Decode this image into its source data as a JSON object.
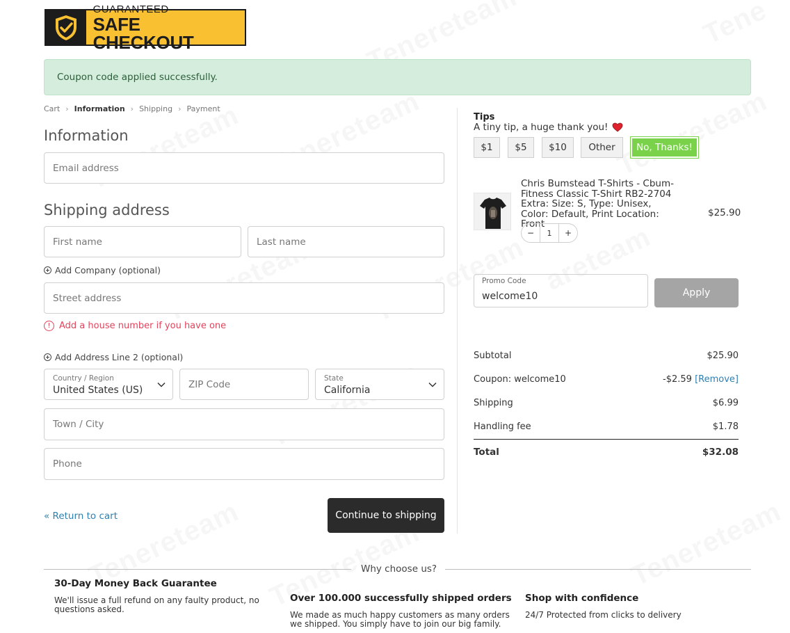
{
  "badge": {
    "top": "GUARANTEED",
    "bottom": "SAFE CHECKOUT"
  },
  "notice": "Coupon code applied successfully.",
  "breadcrumb": [
    "Cart",
    "Information",
    "Shipping",
    "Payment"
  ],
  "information": {
    "heading": "Information",
    "email_placeholder": "Email address"
  },
  "shipping": {
    "heading": "Shipping address",
    "first_name_placeholder": "First name",
    "last_name_placeholder": "Last name",
    "add_company": "Add Company (optional)",
    "street_placeholder": "Street address",
    "street_warning": "Add a house number if you have one",
    "add_line2": "Add Address Line 2 (optional)",
    "country_label": "Country / Region",
    "country_value": "United States (US)",
    "zip_placeholder": "ZIP Code",
    "state_label": "State",
    "state_value": "California",
    "city_placeholder": "Town / City",
    "phone_placeholder": "Phone"
  },
  "actions": {
    "return": "« Return to cart",
    "continue": "Continue to shipping"
  },
  "tips": {
    "title": "Tips",
    "subtitle": "A tiny tip, a huge thank you!",
    "options": [
      "$1",
      "$5",
      "$10",
      "Other",
      "No, Thanks!"
    ],
    "selected": "No, Thanks!",
    "accent": "#7ad24b"
  },
  "product": {
    "name": "Chris Bumstead T-Shirts - Cbum-Fitness Classic T-Shirt RB2-2704",
    "extra": "Extra: Size: S, Type: Unisex, Color: Default, Print Location: Front",
    "price": "$25.90",
    "quantity": "1",
    "minus": "−",
    "plus": "+"
  },
  "promo": {
    "label": "Promo Code",
    "value": "welcome10",
    "apply": "Apply"
  },
  "summary": {
    "subtotal_label": "Subtotal",
    "subtotal": "$25.90",
    "coupon_label": "Coupon: welcome10",
    "coupon_value": "-$2.59",
    "coupon_remove": "[Remove]",
    "shipping_label": "Shipping",
    "shipping": "$6.99",
    "handling_label": "Handling fee",
    "handling": "$1.78",
    "total_label": "Total",
    "total": "$32.08"
  },
  "why": {
    "title": "Why choose us?",
    "features": [
      {
        "title": "30-Day Money Back Guarantee",
        "text": "We'll issue a full refund on any faulty product, no questions asked."
      },
      {
        "title": "Over 100.000 successfully shipped orders",
        "text": "We made as much happy customers as many orders we shipped. You simply have to join our big family."
      },
      {
        "title": "Shop with confidence",
        "text": "24/7 Protected from clicks to delivery"
      }
    ]
  },
  "colors": {
    "badge_bg": "#f9c132",
    "notice_bg": "#d4eddc",
    "warning": "#e2445c",
    "link": "#2f7fb1",
    "button_dark": "#2b2b2b"
  }
}
